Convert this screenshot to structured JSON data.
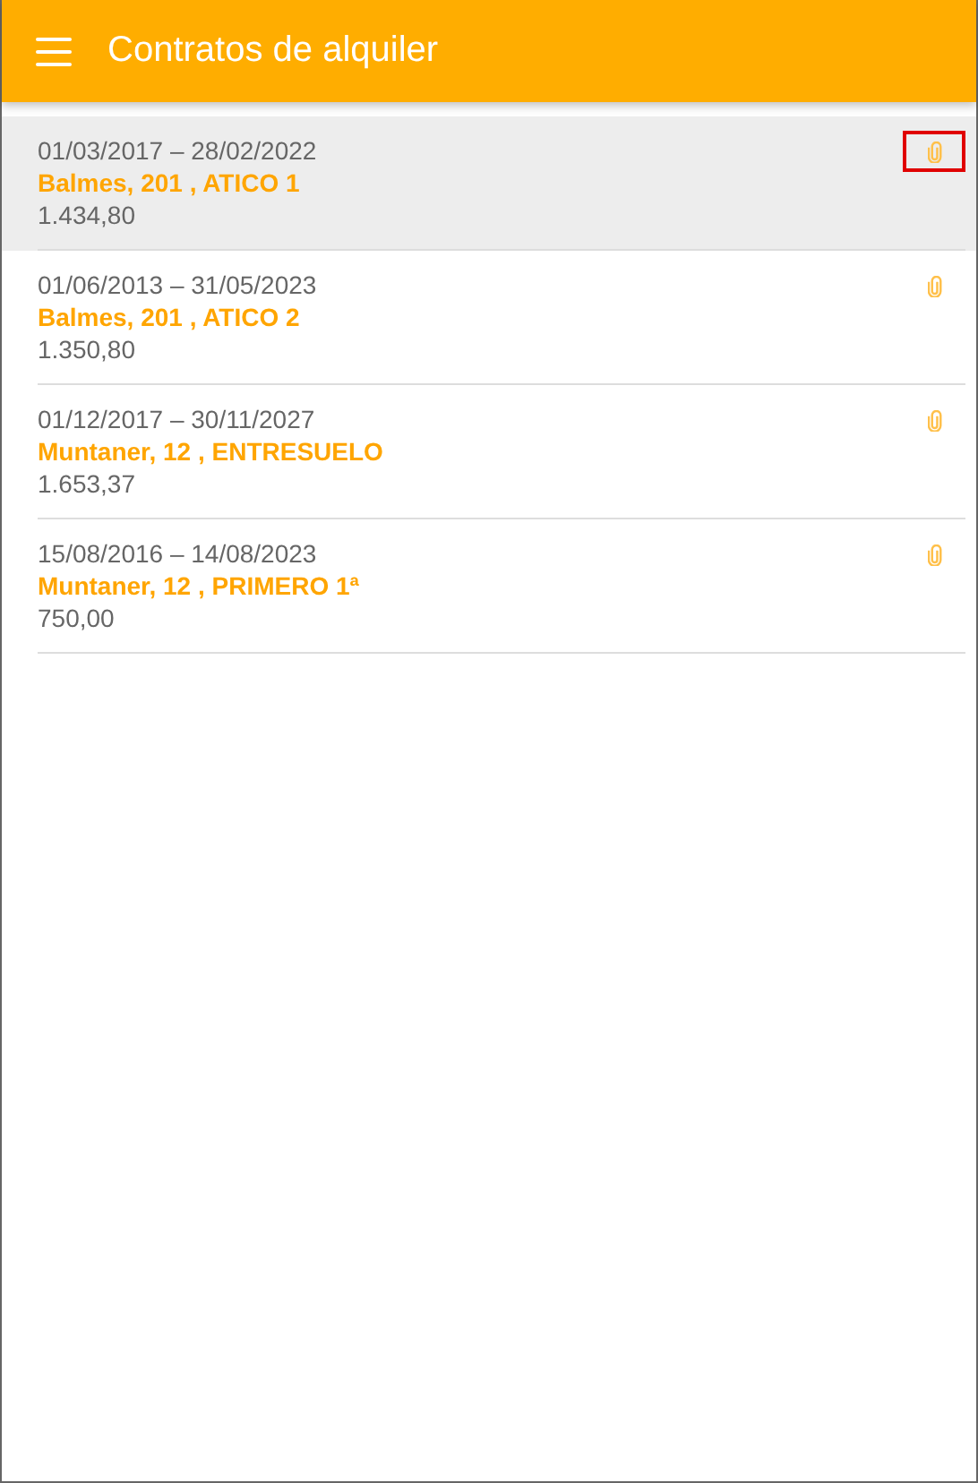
{
  "app_bar": {
    "title": "Contratos de alquiler"
  },
  "contracts": [
    {
      "period": "01/03/2017 – 28/02/2022",
      "address": "Balmes, 201 , ATICO 1",
      "amount": "1.434,80",
      "selected": true,
      "attachment_focused": true
    },
    {
      "period": "01/06/2013 – 31/05/2023",
      "address": "Balmes, 201 , ATICO 2",
      "amount": "1.350,80",
      "selected": false,
      "attachment_focused": false
    },
    {
      "period": "01/12/2017 – 30/11/2027",
      "address": "Muntaner, 12 , ENTRESUELO",
      "amount": "1.653,37",
      "selected": false,
      "attachment_focused": false
    },
    {
      "period": "15/08/2016 – 14/08/2023",
      "address": "Muntaner, 12 , PRIMERO 1ª",
      "amount": "750,00",
      "selected": false,
      "attachment_focused": false
    }
  ]
}
